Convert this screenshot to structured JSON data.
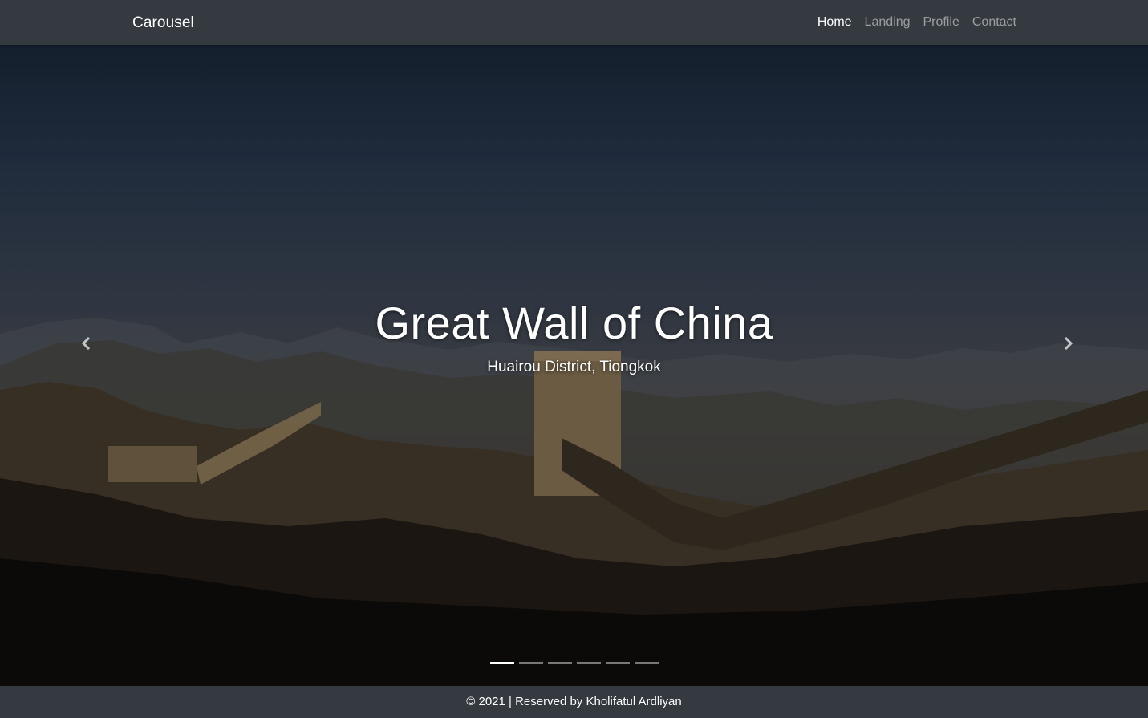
{
  "navbar": {
    "brand": "Carousel",
    "links": [
      {
        "label": "Home",
        "active": true
      },
      {
        "label": "Landing",
        "active": false
      },
      {
        "label": "Profile",
        "active": false
      },
      {
        "label": "Contact",
        "active": false
      }
    ]
  },
  "carousel": {
    "slide": {
      "title": "Great Wall of China",
      "subtitle": "Huairou District, Tiongkok"
    },
    "prev_icon": "chevron-left-icon",
    "next_icon": "chevron-right-icon",
    "indicator_count": 6,
    "active_index": 0
  },
  "footer": {
    "text": "© 2021 | Reserved by Kholifatul Ardliyan"
  },
  "colors": {
    "navbar_bg": "#343a40",
    "text_primary": "#ffffff",
    "nav_inactive": "rgba(255,255,255,0.5)"
  }
}
